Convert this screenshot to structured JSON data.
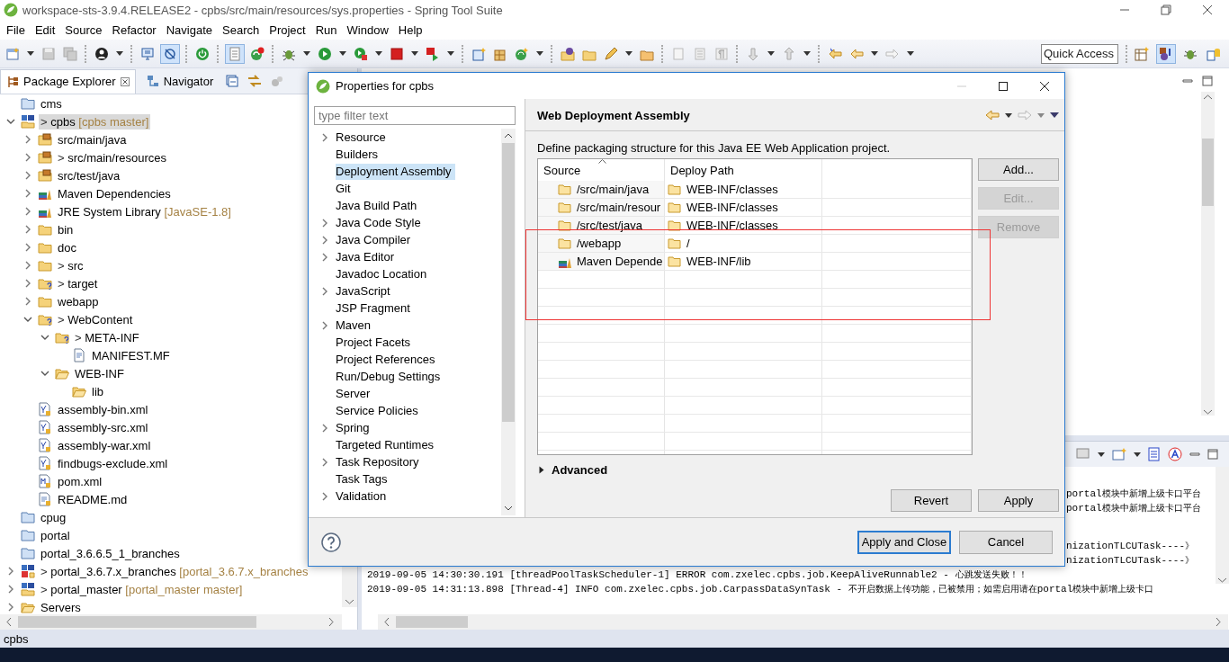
{
  "window": {
    "title": "workspace-sts-3.9.4.RELEASE2 - cpbs/src/main/resources/sys.properties - Spring Tool Suite"
  },
  "menu": [
    "File",
    "Edit",
    "Source",
    "Refactor",
    "Navigate",
    "Search",
    "Project",
    "Run",
    "Window",
    "Help"
  ],
  "quick_access": {
    "placeholder": "Quick Access"
  },
  "explorer": {
    "tabs": [
      {
        "label": "Package Explorer",
        "selected": true
      },
      {
        "label": "Navigator",
        "selected": false
      }
    ],
    "tree": [
      {
        "label": "cms",
        "kind": "project",
        "selected": false
      },
      {
        "label": "cpbs",
        "marker": ">",
        "decoration": "[cpbs master]",
        "kind": "maven-project",
        "selected": true,
        "expanded": true,
        "children": [
          {
            "label": "src/main/java",
            "kind": "source-folder",
            "selected": false,
            "expanded": false
          },
          {
            "label": "src/main/resources",
            "marker": ">",
            "kind": "source-folder",
            "selected": false,
            "expanded": false
          },
          {
            "label": "src/test/java",
            "kind": "source-folder",
            "selected": false,
            "expanded": false
          },
          {
            "label": "Maven Dependencies",
            "kind": "library",
            "selected": false,
            "expanded": false
          },
          {
            "label": "JRE System Library",
            "decoration": "[JavaSE-1.8]",
            "kind": "library",
            "selected": false,
            "expanded": false
          },
          {
            "label": "bin",
            "kind": "folder",
            "selected": false,
            "expanded": false
          },
          {
            "label": "doc",
            "kind": "folder",
            "selected": false,
            "expanded": false
          },
          {
            "label": "src",
            "marker": ">",
            "kind": "folder",
            "selected": false,
            "expanded": false
          },
          {
            "label": "target",
            "marker": ">",
            "kind": "folder-unknown",
            "selected": false,
            "expanded": false
          },
          {
            "label": "webapp",
            "kind": "folder",
            "selected": false,
            "expanded": false
          },
          {
            "label": "WebContent",
            "marker": ">",
            "kind": "folder-unknown",
            "selected": false,
            "expanded": true,
            "children": [
              {
                "label": "META-INF",
                "marker": ">",
                "kind": "folder-unknown",
                "selected": false,
                "expanded": true,
                "children": [
                  {
                    "label": "MANIFEST.MF",
                    "kind": "file",
                    "selected": false
                  }
                ]
              },
              {
                "label": "WEB-INF",
                "kind": "open-folder",
                "selected": false,
                "expanded": true,
                "children": [
                  {
                    "label": "lib",
                    "kind": "open-folder",
                    "selected": false
                  }
                ]
              }
            ]
          },
          {
            "label": "assembly-bin.xml",
            "kind": "xml",
            "selected": false
          },
          {
            "label": "assembly-src.xml",
            "kind": "xml",
            "selected": false
          },
          {
            "label": "assembly-war.xml",
            "kind": "xml",
            "selected": false
          },
          {
            "label": "findbugs-exclude.xml",
            "kind": "xml",
            "selected": false
          },
          {
            "label": "pom.xml",
            "kind": "pom",
            "selected": false
          },
          {
            "label": "README.md",
            "kind": "text",
            "selected": false
          }
        ]
      },
      {
        "label": "cpug",
        "kind": "project",
        "selected": false
      },
      {
        "label": "portal",
        "kind": "project",
        "selected": false
      },
      {
        "label": "portal_3.6.6.5_1_branches",
        "kind": "project",
        "selected": false
      },
      {
        "label": "portal_3.6.7.x_branches",
        "marker": ">",
        "decoration": "[portal_3.6.7.x_branches",
        "kind": "maven-project-error",
        "selected": false,
        "expanded": false
      },
      {
        "label": "portal_master",
        "marker": ">",
        "decoration": "[portal_master master]",
        "kind": "maven-project",
        "selected": false,
        "expanded": false
      },
      {
        "label": "Servers",
        "kind": "open-folder",
        "selected": false,
        "expanded": false
      }
    ]
  },
  "console": {
    "lines": [
      {
        "kind": "tail",
        "text": "portal模块中新增上级卡口平台"
      },
      {
        "kind": "tail",
        "text": "portal模块中新增上级卡口平台"
      },
      {
        "kind": "tail",
        "text": "nizationTLCUTask----》"
      },
      {
        "kind": "tail",
        "text": "nizationTLCUTask----》"
      },
      {
        "kind": "full",
        "text": "2019-09-05 14:30:30.191 [threadPoolTaskScheduler-1] ERROR com.zxelec.cpbs.job.KeepAliveRunnable2 - 心跳发送失败！！"
      },
      {
        "kind": "full",
        "text": "2019-09-05 14:31:13.898 [Thread-4] INFO  com.zxelec.cpbs.job.CarpassDataSynTask - 不开启数据上传功能，已被禁用；如需启用请在portal模块中新增上级卡口"
      }
    ]
  },
  "status_bar": {
    "text": "cpbs"
  },
  "dialog": {
    "title": "Properties for cpbs",
    "filter": {
      "placeholder": "type filter text"
    },
    "nav": [
      {
        "label": "Resource",
        "expanded": false,
        "selected": false
      },
      {
        "label": "Builders",
        "selected": false
      },
      {
        "label": "Deployment Assembly",
        "selected": true
      },
      {
        "label": "Git",
        "selected": false
      },
      {
        "label": "Java Build Path",
        "selected": false
      },
      {
        "label": "Java Code Style",
        "expanded": false,
        "selected": false
      },
      {
        "label": "Java Compiler",
        "expanded": false,
        "selected": false
      },
      {
        "label": "Java Editor",
        "expanded": false,
        "selected": false
      },
      {
        "label": "Javadoc Location",
        "selected": false
      },
      {
        "label": "JavaScript",
        "expanded": false,
        "selected": false
      },
      {
        "label": "JSP Fragment",
        "selected": false
      },
      {
        "label": "Maven",
        "expanded": false,
        "selected": false
      },
      {
        "label": "Project Facets",
        "selected": false
      },
      {
        "label": "Project References",
        "selected": false
      },
      {
        "label": "Run/Debug Settings",
        "selected": false
      },
      {
        "label": "Server",
        "selected": false
      },
      {
        "label": "Service Policies",
        "selected": false
      },
      {
        "label": "Spring",
        "expanded": false,
        "selected": false
      },
      {
        "label": "Targeted Runtimes",
        "selected": false
      },
      {
        "label": "Task Repository",
        "expanded": false,
        "selected": false
      },
      {
        "label": "Task Tags",
        "selected": false
      },
      {
        "label": "Validation",
        "expanded": false,
        "selected": false
      }
    ],
    "page_title": "Web Deployment Assembly",
    "description": "Define packaging structure for this Java EE Web Application project.",
    "table": {
      "columns": [
        "Source",
        "Deploy Path"
      ],
      "rows": [
        {
          "kind": "folder",
          "source": "/src/main/java",
          "deploy_path": "WEB-INF/classes"
        },
        {
          "kind": "folder",
          "source": "/src/main/resour",
          "deploy_path": "WEB-INF/classes"
        },
        {
          "kind": "folder",
          "source": "/src/test/java",
          "deploy_path": "WEB-INF/classes"
        },
        {
          "kind": "folder",
          "source": "/webapp",
          "deploy_path": "/"
        },
        {
          "kind": "library",
          "source": "Maven Depende",
          "deploy_path": "WEB-INF/lib"
        }
      ]
    },
    "side_buttons": [
      {
        "label": "Add...",
        "disabled": false
      },
      {
        "label": "Edit...",
        "disabled": true
      },
      {
        "label": "Remove",
        "disabled": true
      }
    ],
    "advanced": {
      "label": "Advanced",
      "expanded": false
    },
    "page_buttons": [
      {
        "label": "Revert",
        "disabled": false
      },
      {
        "label": "Apply",
        "disabled": false
      }
    ],
    "footer_buttons": [
      {
        "label": "Apply and Close",
        "default": true
      },
      {
        "label": "Cancel",
        "default": false
      }
    ]
  }
}
